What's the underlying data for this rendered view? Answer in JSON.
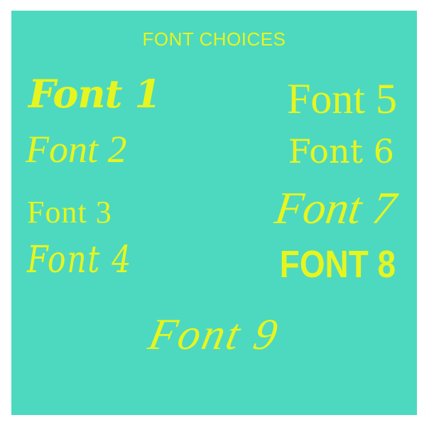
{
  "title": "FONT CHOICES",
  "fonts": [
    "Font 1",
    "Font 2",
    "Font 3",
    "Font 4",
    "Font 5",
    "Font 6",
    "Font 7",
    "FONT 8",
    "Font 9"
  ],
  "colors": {
    "background": "#4dd9bf",
    "text": "#e6f51f"
  }
}
